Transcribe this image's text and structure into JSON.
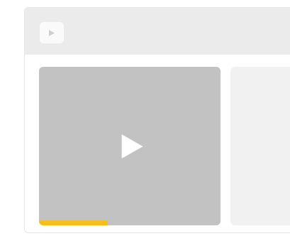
{
  "header": {
    "icon": "small-play-icon"
  },
  "video": {
    "icon": "play-icon",
    "progress_fraction": 0.38,
    "progress_color": "#f4bf1a"
  },
  "colors": {
    "header_bg": "#ebebeb",
    "thumbnail_bg": "#c2c2c2",
    "next_card_bg": "#f1f1f1"
  }
}
